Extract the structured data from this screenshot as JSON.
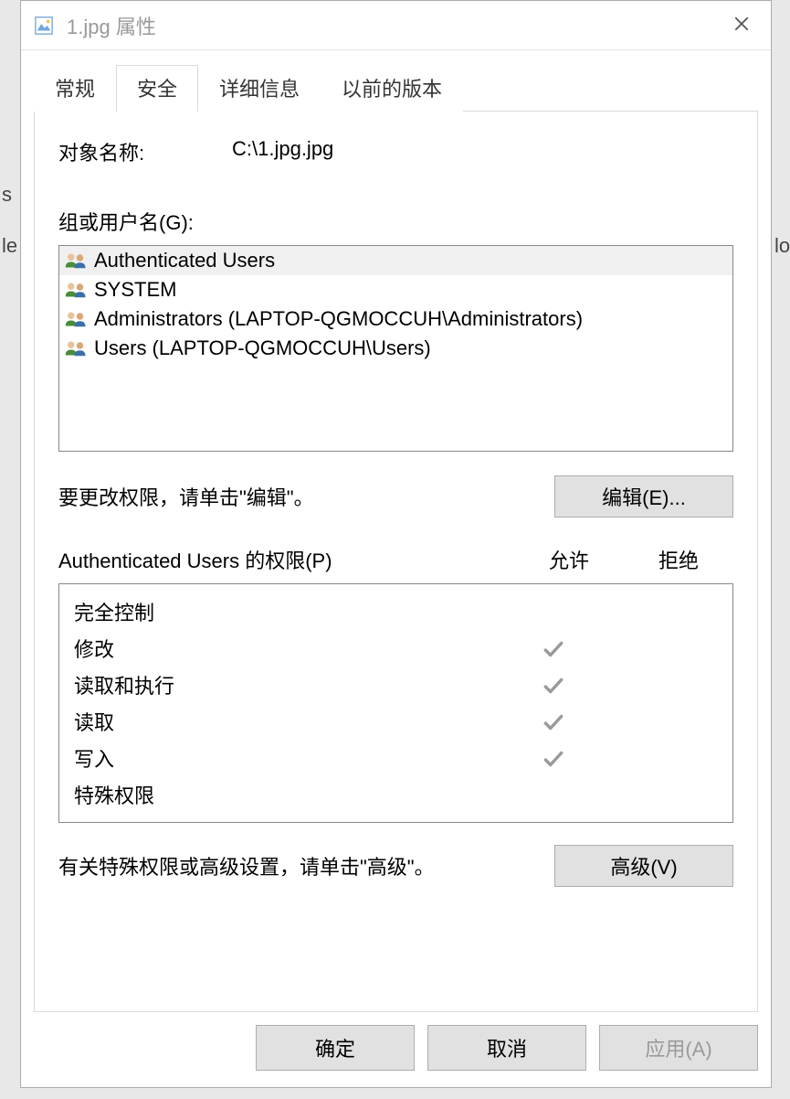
{
  "window": {
    "title": "1.jpg 属性"
  },
  "tabs": {
    "general": "常规",
    "security": "安全",
    "details": "详细信息",
    "previous": "以前的版本"
  },
  "object": {
    "label": "对象名称:",
    "value": "C:\\1.jpg.jpg"
  },
  "groups": {
    "label": "组或用户名(G):",
    "items": [
      {
        "name": "Authenticated Users",
        "selected": true
      },
      {
        "name": "SYSTEM",
        "selected": false
      },
      {
        "name": "Administrators (LAPTOP-QGMOCCUH\\Administrators)",
        "selected": false
      },
      {
        "name": "Users (LAPTOP-QGMOCCUH\\Users)",
        "selected": false
      }
    ]
  },
  "edit": {
    "hint": "要更改权限，请单击\"编辑\"。",
    "button": "编辑(E)..."
  },
  "permissions": {
    "header_name": "Authenticated Users 的权限(P)",
    "header_allow": "允许",
    "header_deny": "拒绝",
    "rows": [
      {
        "name": "完全控制",
        "allow": false,
        "deny": false
      },
      {
        "name": "修改",
        "allow": true,
        "deny": false
      },
      {
        "name": "读取和执行",
        "allow": true,
        "deny": false
      },
      {
        "name": "读取",
        "allow": true,
        "deny": false
      },
      {
        "name": "写入",
        "allow": true,
        "deny": false
      },
      {
        "name": "特殊权限",
        "allow": false,
        "deny": false
      }
    ]
  },
  "advanced": {
    "hint": "有关特殊权限或高级设置，请单击\"高级\"。",
    "button": "高级(V)"
  },
  "footer": {
    "ok": "确定",
    "cancel": "取消",
    "apply": "应用(A)"
  }
}
